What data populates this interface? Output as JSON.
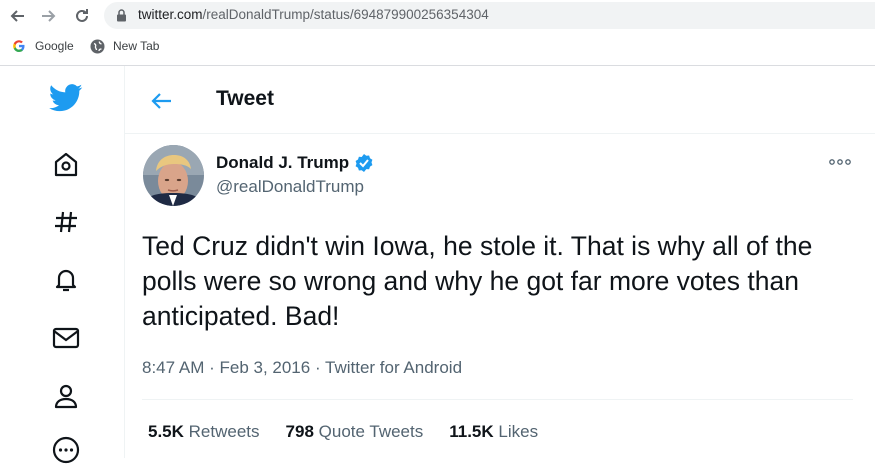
{
  "browser": {
    "url_host": "twitter.com",
    "url_path": "/realDonaldTrump/status/694879900256354304",
    "bookmarks": [
      {
        "label": "Google",
        "icon": "google-icon"
      },
      {
        "label": "New Tab",
        "icon": "globe-icon"
      }
    ]
  },
  "twitter": {
    "header_title": "Tweet",
    "author": {
      "name": "Donald J. Trump",
      "handle": "@realDonaldTrump",
      "verified": true
    },
    "tweet": {
      "text": "Ted Cruz didn't win Iowa, he stole it. That is why all of the polls were so wrong and why he got far more votes than anticipated. Bad!",
      "meta": "8:47 AM · Feb 3, 2016 · Twitter for Android"
    },
    "stats": {
      "retweets_count": "5.5K",
      "retweets_label": "Retweets",
      "quotes_count": "798",
      "quotes_label": "Quote Tweets",
      "likes_count": "11.5K",
      "likes_label": "Likes"
    },
    "colors": {
      "brand": "#1d9bf0",
      "text": "#0f1419",
      "secondary": "#536471"
    }
  }
}
